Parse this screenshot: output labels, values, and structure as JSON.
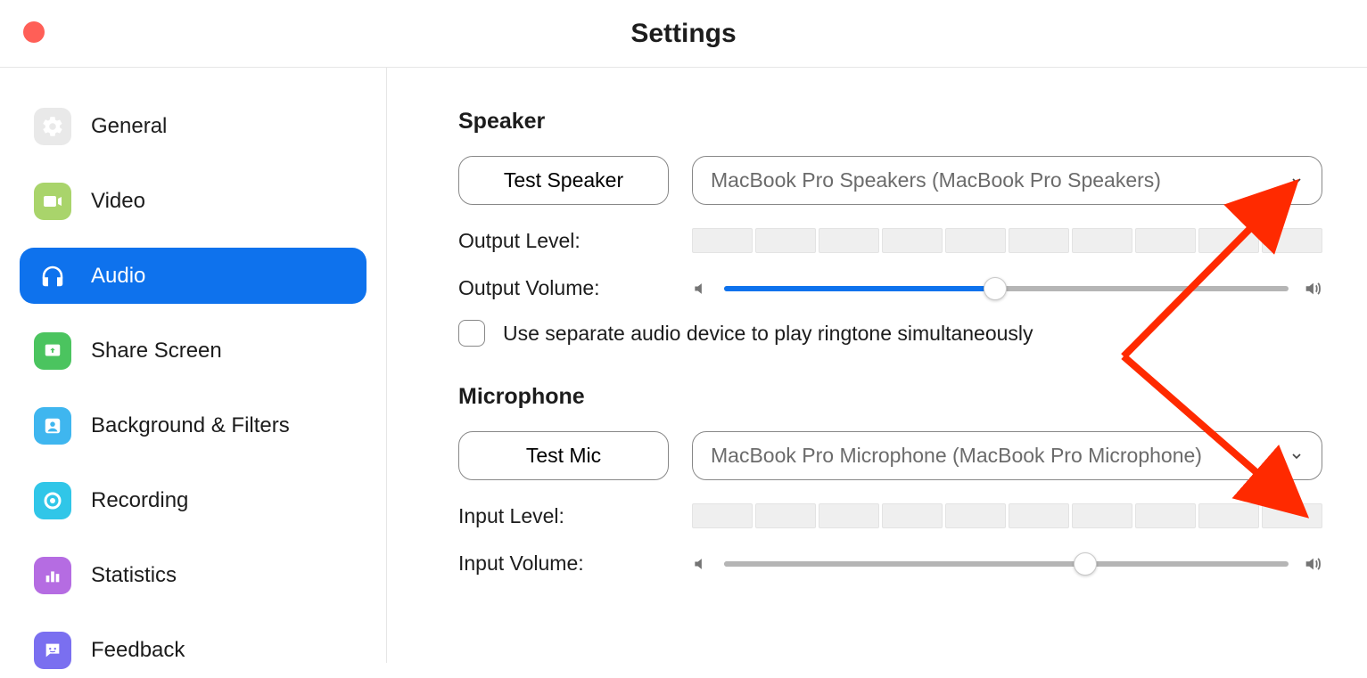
{
  "window": {
    "title": "Settings"
  },
  "sidebar": {
    "items": [
      {
        "label": "General"
      },
      {
        "label": "Video"
      },
      {
        "label": "Audio"
      },
      {
        "label": "Share Screen"
      },
      {
        "label": "Background & Filters"
      },
      {
        "label": "Recording"
      },
      {
        "label": "Statistics"
      },
      {
        "label": "Feedback"
      }
    ],
    "active_index": 2
  },
  "speaker": {
    "section_title": "Speaker",
    "test_button": "Test Speaker",
    "device": "MacBook Pro Speakers (MacBook Pro Speakers)",
    "output_level_label": "Output Level:",
    "output_level_segments": 10,
    "output_level_value": 0,
    "output_volume_label": "Output Volume:",
    "output_volume_percent": 48,
    "separate_device_checkbox": {
      "checked": false,
      "label": "Use separate audio device to play ringtone simultaneously"
    }
  },
  "microphone": {
    "section_title": "Microphone",
    "test_button": "Test Mic",
    "device": "MacBook Pro Microphone (MacBook Pro Microphone)",
    "input_level_label": "Input Level:",
    "input_level_segments": 10,
    "input_level_value": 0,
    "input_volume_label": "Input Volume:",
    "input_volume_percent": 64
  },
  "annotation": {
    "type": "two-arrows",
    "color": "#ff2a00",
    "description": "Two red arrows pointing to speaker and microphone device dropdowns"
  }
}
